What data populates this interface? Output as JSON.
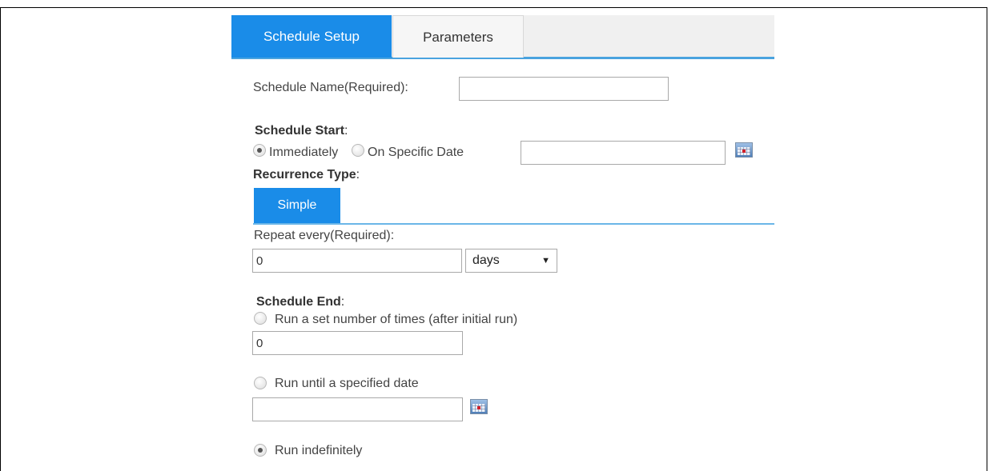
{
  "tabs": [
    {
      "label": "Schedule Setup",
      "active": true
    },
    {
      "label": "Parameters",
      "active": false
    }
  ],
  "schedule_name": {
    "label": "Schedule Name(Required):",
    "value": ""
  },
  "schedule_start": {
    "heading": "Schedule Start",
    "colon": ":",
    "options": [
      {
        "label": "Immediately",
        "selected": true
      },
      {
        "label": "On Specific Date",
        "selected": false
      }
    ],
    "date_value": ""
  },
  "recurrence": {
    "heading": "Recurrence Type",
    "colon": ":",
    "tab_label": "Simple",
    "repeat_label": "Repeat every(Required):",
    "repeat_value": "0",
    "unit_selected": "days",
    "unit_arrow": "▼"
  },
  "schedule_end": {
    "heading": "Schedule End",
    "colon": ":",
    "option_times": {
      "label": "Run a set number of times (after initial run)",
      "selected": false,
      "value": "0"
    },
    "option_until": {
      "label": "Run until a specified date",
      "selected": false,
      "value": ""
    },
    "option_indef": {
      "label": "Run indefinitely",
      "selected": true
    }
  },
  "colors": {
    "accent": "#1a8ce8",
    "rule": "#4aa3df"
  }
}
